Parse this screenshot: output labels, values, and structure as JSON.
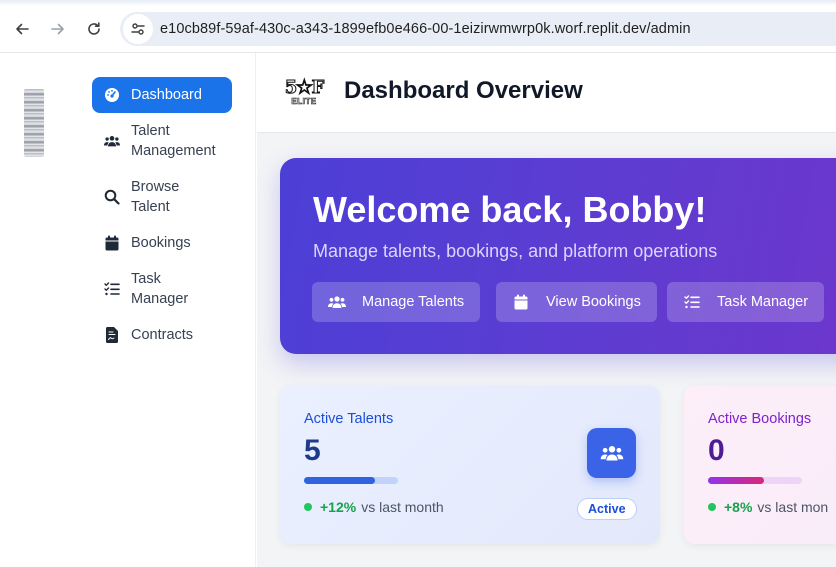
{
  "browser": {
    "url": "e10cb89f-59af-430c-a343-1899efb0e466-00-1eizirwmwrp0k.worf.replit.dev/admin"
  },
  "sidebar": {
    "items": [
      {
        "label": "Dashboard",
        "icon": "gauge-icon",
        "active": true
      },
      {
        "label": "Talent Management",
        "icon": "users-icon",
        "active": false
      },
      {
        "label": "Browse Talent",
        "icon": "search-icon",
        "active": false
      },
      {
        "label": "Bookings",
        "icon": "calendar-icon",
        "active": false
      },
      {
        "label": "Task Manager",
        "icon": "tasks-icon",
        "active": false
      },
      {
        "label": "Contracts",
        "icon": "file-contract-icon",
        "active": false
      }
    ]
  },
  "header": {
    "title": "Dashboard Overview",
    "logo_text": "5★F",
    "logo_subtext": "ELITE"
  },
  "hero": {
    "title": "Welcome back, Bobby!",
    "subtitle": "Manage talents, bookings, and platform operations",
    "buttons": [
      {
        "label": "Manage Talents",
        "icon": "users-icon"
      },
      {
        "label": "View Bookings",
        "icon": "calendar-icon"
      },
      {
        "label": "Task Manager",
        "icon": "tasks-icon"
      }
    ]
  },
  "stats": [
    {
      "label": "Active Talents",
      "value": "5",
      "progress": 0.75,
      "trend_pct": "+12%",
      "trend_text": "vs last month",
      "badge": "Active",
      "icon": "users-icon"
    },
    {
      "label": "Active Bookings",
      "value": "0",
      "progress": 0.6,
      "trend_pct": "+8%",
      "trend_text": "vs last mon",
      "icon": ""
    }
  ],
  "colors": {
    "accent": "#1a73e8",
    "hero_start": "#4c3fd6",
    "hero_end": "#6e36cc",
    "positive": "#16a34a",
    "talent_value": "#1e3a8a",
    "booking_value": "#4c1d95"
  }
}
